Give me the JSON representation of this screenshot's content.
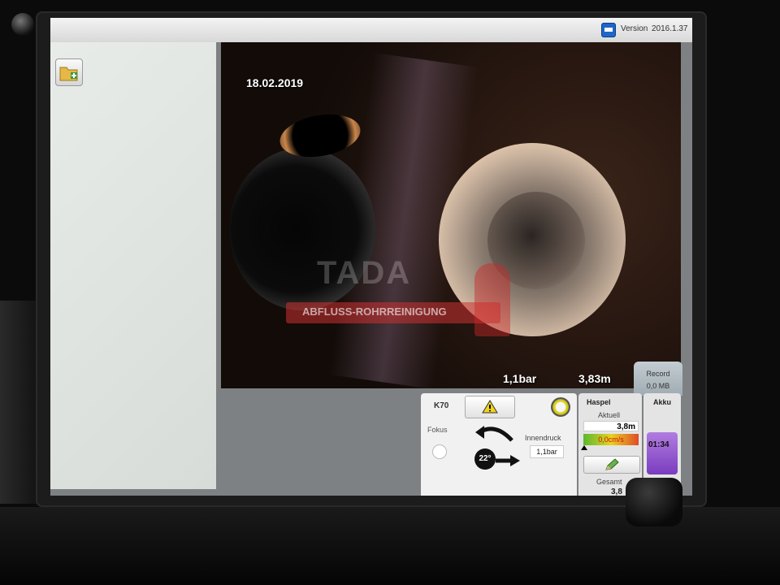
{
  "titlebar": {
    "version_label": "Version",
    "version_number": "2016.1.37"
  },
  "video": {
    "date": "18.02.2019",
    "pressure": "1,1bar",
    "distance": "3,83m",
    "watermark_title": "TADA",
    "watermark_subtitle": "ABFLUSS-ROHRREINIGUNG"
  },
  "record": {
    "label": "Record",
    "size": "0,0 MB"
  },
  "camera_controls": {
    "model": "K70",
    "focus_label": "Fokus",
    "pressure_label": "Innendruck",
    "pressure_value": "1,1bar",
    "angle": "22°"
  },
  "haspel": {
    "title": "Haspel",
    "current_label": "Aktuell",
    "current_value": "3,8m",
    "speed": "0,0cm/s",
    "total_label": "Gesamt",
    "total_value": "3,8"
  },
  "akku": {
    "title": "Akku",
    "time": "01:34"
  },
  "icons": [
    "power-orb-icon",
    "version-icon",
    "folder-add-icon",
    "warning-icon",
    "power-icon",
    "rotate-arrow-icon",
    "right-arrow-icon",
    "pencil-icon"
  ],
  "colors": {
    "accent_yellow": "#e6dd38",
    "battery_purple": "#8a4ccf",
    "speed_text": "#d01010"
  }
}
